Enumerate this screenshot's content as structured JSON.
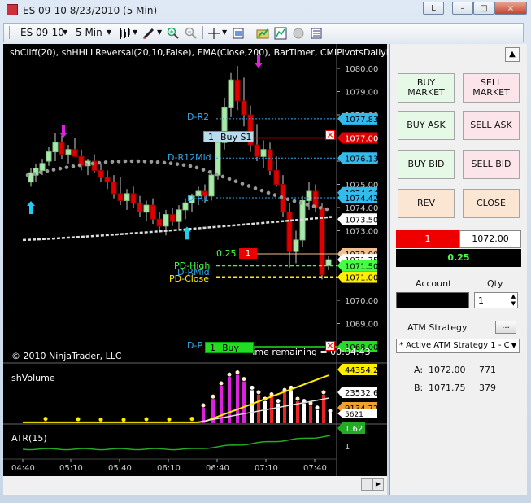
{
  "window": {
    "title": "ES 09-10  8/23/2010 (5 Min)",
    "btn_l": "L",
    "btn_min": "–",
    "btn_max": "□",
    "btn_close": "×"
  },
  "toolbar": {
    "instrument": "ES 09-10",
    "period": "5 Min"
  },
  "chart": {
    "indicator_header": "shCliff(20), shHHLLReversal(20,10,False), EMA(Close,200), BarTimer, CMIPivotsDailyDash_",
    "copyright": "© 2010 NinjaTrader, LLC",
    "volume_panel_label": "shVolume",
    "atr_panel_label": "ATR(15)",
    "bar_timer": "Time remaining = 00:04:43",
    "pivot_labels": {
      "r2": "D-R2",
      "r12mid": "D-R12Mid",
      "r1": "D-R1",
      "pd_high": "PD-High",
      "rmid": "D-RMid",
      "pd_close": "PD-Close",
      "d_p": "D-P"
    },
    "orders": {
      "buy_s1_qty": "1",
      "buy_s1_label": "Buy S1",
      "buy_t1_qty": "1",
      "buy_t1_label": "Buy T1",
      "close_x": "×",
      "pos_price": "0.25",
      "pos_qty": "1"
    },
    "price_axis_labels": [
      "1080.00",
      "1079.00",
      "1078.00",
      "1077.00",
      "1076.00",
      "1075.00",
      "1074.00",
      "1073.00",
      "1072.00",
      "1071.00",
      "1070.00",
      "1069.00",
      "1068.00"
    ],
    "price_tags": [
      {
        "value": "1077.83",
        "color": "#33bbee",
        "text_color": "#000"
      },
      {
        "value": "1077.00",
        "color": "#e00000",
        "text_color": "#fff"
      },
      {
        "value": "1076.13",
        "color": "#33bbee",
        "text_color": "#000"
      },
      {
        "value": "1074.64",
        "color": "#33bbee",
        "text_color": "#000"
      },
      {
        "value": "1074.42",
        "color": "#33bbee",
        "text_color": "#000"
      },
      {
        "value": "1073.50",
        "color": "#ffffff",
        "text_color": "#000"
      },
      {
        "value": "1072.00",
        "color": "#f0c090",
        "text_color": "#000"
      },
      {
        "value": "1071.75",
        "color": "#ffffff",
        "text_color": "#000"
      },
      {
        "value": "1071.50",
        "color": "#44ff44",
        "text_color": "#000"
      },
      {
        "value": "1071.00",
        "color": "#ffee00",
        "text_color": "#000"
      },
      {
        "value": "1068.00",
        "color": "#22dd22",
        "text_color": "#000"
      }
    ],
    "volume_tags": [
      {
        "value": "44354.2",
        "color": "#ffee00"
      },
      {
        "value": "23532.6",
        "color": "#ffffff"
      },
      {
        "value": "9134.72",
        "color": "#f0a030"
      }
    ],
    "volume_tag_partial": "5621",
    "atr_tags": [
      {
        "value": "1.62",
        "color": "#22aa22"
      }
    ],
    "atr_axis_label": "1",
    "time_labels": [
      "04:40",
      "05:10",
      "05:40",
      "06:10",
      "06:40",
      "07:10",
      "07:40"
    ]
  },
  "panel": {
    "buy_market": "BUY\nMARKET",
    "sell_market": "SELL\nMARKET",
    "buy_ask": "BUY ASK",
    "sell_ask": "SELL ASK",
    "buy_bid": "BUY BID",
    "sell_bid": "SELL BID",
    "rev": "REV",
    "close": "CLOSE",
    "position_qty": "1",
    "position_price": "1072.00",
    "pnl": "0.25",
    "account_label": "Account",
    "qty_label": "Qty",
    "qty_value": "1",
    "atm_label": "ATM Strategy",
    "atm_more": "...",
    "atm_value": "* Active ATM Strategy 1 - C",
    "bid_a_label": "A:",
    "bid_a_price": "1072.00",
    "bid_a_size": "771",
    "bid_b_label": "B:",
    "bid_b_price": "1071.75",
    "bid_b_size": "379",
    "up_arrow": "▲"
  }
}
